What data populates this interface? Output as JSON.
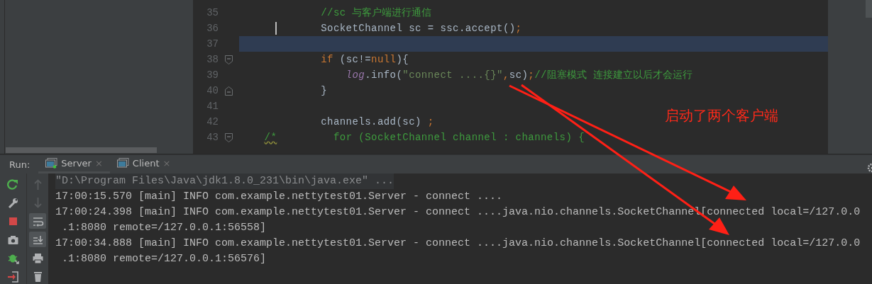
{
  "editor": {
    "lines": [
      {
        "number": "35",
        "tokens": [
          {
            "text": "            //sc 与客户端进行通信",
            "kind": "comment"
          }
        ]
      },
      {
        "number": "36",
        "caret": true,
        "tokens": [
          {
            "text": "            SocketChannel sc = ssc.accept()",
            "kind": "plain"
          },
          {
            "text": ";",
            "kind": "keyword"
          }
        ]
      },
      {
        "number": "37",
        "highlighted": true
      },
      {
        "number": "38",
        "fold_start": true,
        "tokens": [
          {
            "text": "            if ",
            "kind": "keyword"
          },
          {
            "text": "(sc!=",
            "kind": "plain"
          },
          {
            "text": "null",
            "kind": "keyword"
          },
          {
            "text": "){",
            "kind": "plain"
          }
        ]
      },
      {
        "number": "39",
        "tokens": [
          {
            "text": "                log",
            "kind": "field"
          },
          {
            "text": ".info(",
            "kind": "plain"
          },
          {
            "text": "\"connect ....{}\"",
            "kind": "string"
          },
          {
            "text": ",",
            "kind": "keyword"
          },
          {
            "text": "sc)",
            "kind": "plain"
          },
          {
            "text": ";",
            "kind": "keyword"
          },
          {
            "text": "//阻塞模式 连接建立以后才会运行",
            "kind": "comment"
          }
        ]
      },
      {
        "number": "40",
        "fold_end": true,
        "tokens": [
          {
            "text": "            }",
            "kind": "plain"
          }
        ]
      },
      {
        "number": "41"
      },
      {
        "number": "42",
        "tokens": [
          {
            "text": "            channels.add(sc) ",
            "kind": "plain"
          },
          {
            "text": ";",
            "kind": "keyword"
          }
        ]
      },
      {
        "number": "43",
        "fold_start": true,
        "tokens": [
          {
            "text": "   /*",
            "kind": "comment",
            "warning": true
          },
          {
            "text": "         for (SocketChannel channel : channels) {",
            "kind": "comment"
          }
        ]
      }
    ]
  },
  "annotation": {
    "text": "启动了两个客户端"
  },
  "run_panel": {
    "title": "Run:",
    "tabs": [
      {
        "label": "Server",
        "close": "×",
        "selected": true,
        "running": true
      },
      {
        "label": "Client",
        "close": "×",
        "selected": false,
        "running": false
      }
    ],
    "toolbar_left": [
      {
        "kind": "rerun"
      },
      {
        "kind": "wrench"
      },
      {
        "kind": "stop"
      },
      {
        "kind": "camera"
      },
      {
        "kind": "debug"
      },
      {
        "kind": "exit"
      }
    ],
    "toolbar_right": [
      {
        "kind": "up",
        "disabled": true,
        "on": false
      },
      {
        "kind": "down",
        "disabled": true,
        "on": false
      },
      {
        "kind": "wrap",
        "disabled": false,
        "on": true
      },
      {
        "kind": "scroll-end",
        "disabled": false,
        "on": true
      },
      {
        "kind": "print",
        "disabled": false,
        "on": false
      },
      {
        "kind": "trash",
        "disabled": false,
        "on": false
      }
    ],
    "console": [
      {
        "kind": "command",
        "text": "\"D:\\Program Files\\Java\\jdk1.8.0_231\\bin\\java.exe\" ..."
      },
      {
        "kind": "log",
        "text": "17:00:15.570 [main] INFO com.example.nettytest01.Server - connect ...."
      },
      {
        "kind": "log",
        "text": "17:00:24.398 [main] INFO com.example.nettytest01.Server - connect ....java.nio.channels.SocketChannel[connected local=/127.0.0"
      },
      {
        "kind": "log",
        "text": " .1:8080 remote=/127.0.0.1:56558]"
      },
      {
        "kind": "log",
        "text": "17:00:34.888 [main] INFO com.example.nettytest01.Server - connect ....java.nio.channels.SocketChannel[connected local=/127.0.0"
      },
      {
        "kind": "log",
        "text": " .1:8080 remote=/127.0.0.1:56576]"
      }
    ]
  }
}
